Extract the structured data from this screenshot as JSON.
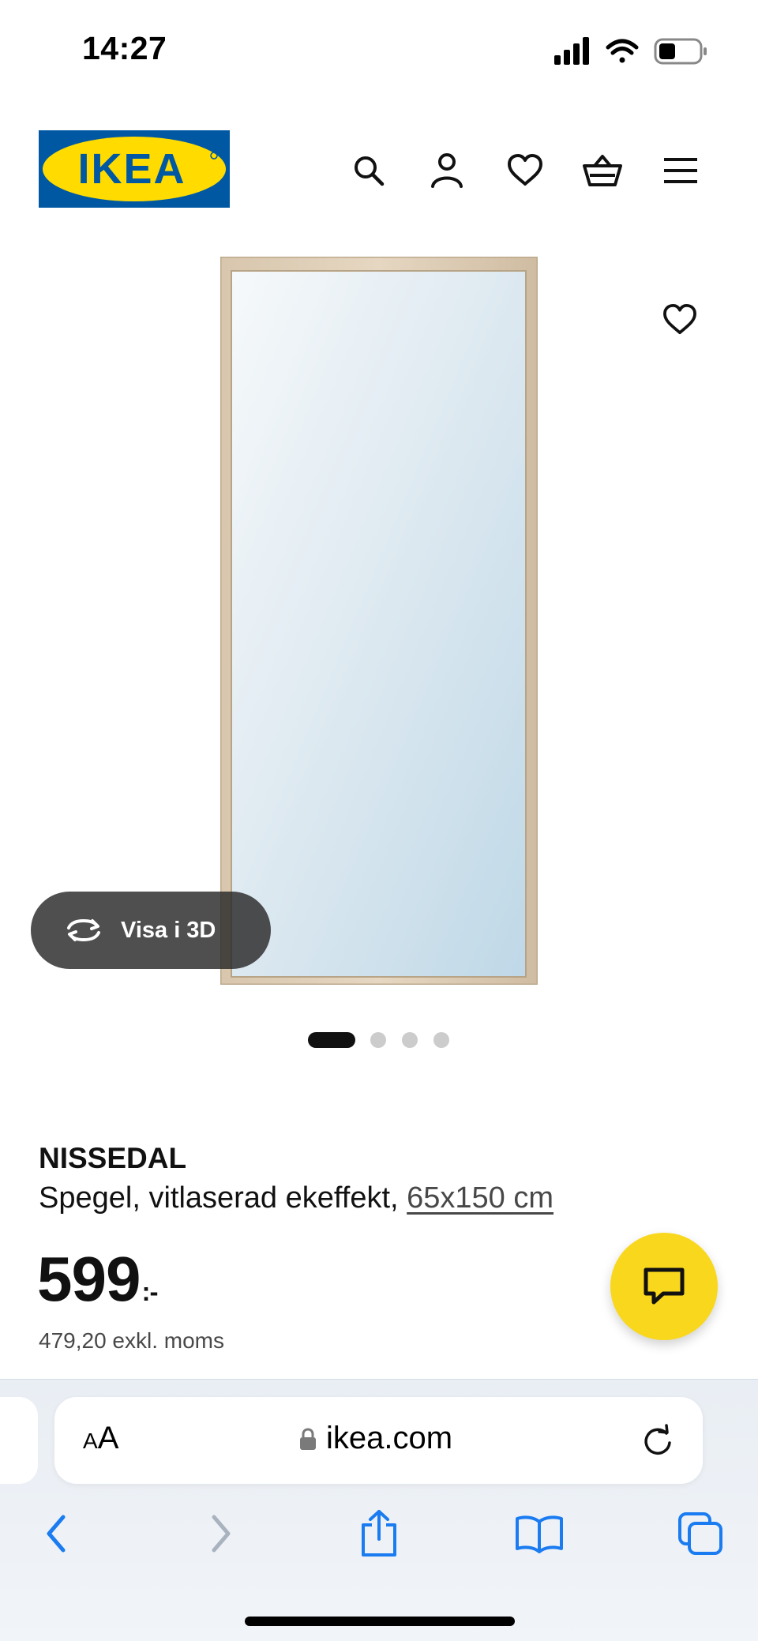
{
  "status_bar": {
    "time": "14:27"
  },
  "header": {
    "logo_text": "IKEA",
    "icons": [
      "search-icon",
      "account-icon",
      "heart-icon",
      "cart-icon",
      "menu-icon"
    ]
  },
  "gallery": {
    "favorite_icon": "heart-icon",
    "view_3d_label": "Visa i 3D",
    "dots_count": 4,
    "active_dot": 1
  },
  "product": {
    "name": "NISSEDAL",
    "description": "Spegel, vitlaserad ekeffekt,",
    "size": "65x150 cm",
    "price": "599",
    "price_suffix": ":-",
    "price_excl_vat": "479,20 exkl. moms"
  },
  "browser": {
    "aa_small": "A",
    "aa_large": "A",
    "url": "ikea.com"
  },
  "colors": {
    "ikea_blue": "#0058a3",
    "ikea_yellow": "#ffdb00",
    "chat_yellow": "#f9d71c",
    "safari_blue": "#1a7cf0"
  }
}
